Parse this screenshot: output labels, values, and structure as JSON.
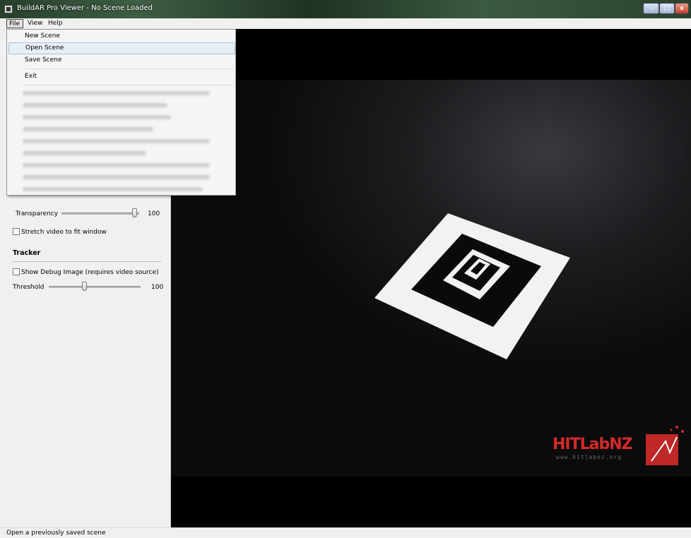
{
  "window": {
    "title": "BuildAR Pro Viewer - No Scene Loaded",
    "minimize_glyph": "–",
    "maximize_glyph": "□",
    "close_glyph": "x"
  },
  "menubar": {
    "file": "File",
    "view": "View",
    "help": "Help"
  },
  "file_menu": {
    "items": [
      "New Scene",
      "Open Scene",
      "Save Scene",
      "Exit"
    ],
    "highlighted": "Open Scene",
    "recent_files_obscured": true
  },
  "left_panel": {
    "transparency": {
      "label": "Transparency",
      "value": "100",
      "fraction": 1.0
    },
    "stretch_video": {
      "label": "Stretch video to fit window",
      "checked": false
    },
    "tracker": {
      "title": "Tracker"
    },
    "debug_image": {
      "label": "Show Debug Image (requires video source)",
      "checked": false
    },
    "threshold": {
      "label": "Threshold",
      "value": "100",
      "fraction": 0.39
    }
  },
  "video": {
    "logo_text": "HITLabNZ",
    "logo_url": "www.hitlabnz.org"
  },
  "statusbar": {
    "text": "Open a previously saved scene"
  },
  "colors": {
    "logo_red": "#d42a2a",
    "highlight_border": "#a8c0dc",
    "video_bg": "#050505"
  }
}
